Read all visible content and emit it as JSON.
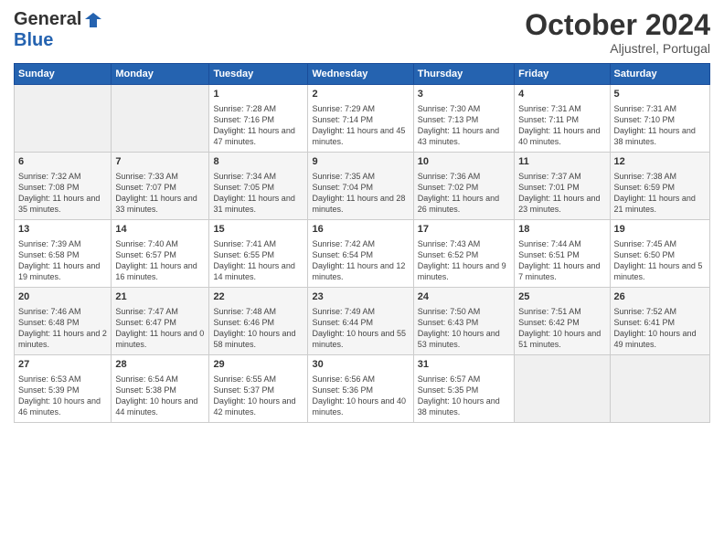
{
  "header": {
    "logo_line1": "General",
    "logo_line2": "Blue",
    "month": "October 2024",
    "location": "Aljustrel, Portugal"
  },
  "days_of_week": [
    "Sunday",
    "Monday",
    "Tuesday",
    "Wednesday",
    "Thursday",
    "Friday",
    "Saturday"
  ],
  "weeks": [
    [
      {
        "day": "",
        "content": ""
      },
      {
        "day": "",
        "content": ""
      },
      {
        "day": "1",
        "content": "Sunrise: 7:28 AM\nSunset: 7:16 PM\nDaylight: 11 hours and 47 minutes."
      },
      {
        "day": "2",
        "content": "Sunrise: 7:29 AM\nSunset: 7:14 PM\nDaylight: 11 hours and 45 minutes."
      },
      {
        "day": "3",
        "content": "Sunrise: 7:30 AM\nSunset: 7:13 PM\nDaylight: 11 hours and 43 minutes."
      },
      {
        "day": "4",
        "content": "Sunrise: 7:31 AM\nSunset: 7:11 PM\nDaylight: 11 hours and 40 minutes."
      },
      {
        "day": "5",
        "content": "Sunrise: 7:31 AM\nSunset: 7:10 PM\nDaylight: 11 hours and 38 minutes."
      }
    ],
    [
      {
        "day": "6",
        "content": "Sunrise: 7:32 AM\nSunset: 7:08 PM\nDaylight: 11 hours and 35 minutes."
      },
      {
        "day": "7",
        "content": "Sunrise: 7:33 AM\nSunset: 7:07 PM\nDaylight: 11 hours and 33 minutes."
      },
      {
        "day": "8",
        "content": "Sunrise: 7:34 AM\nSunset: 7:05 PM\nDaylight: 11 hours and 31 minutes."
      },
      {
        "day": "9",
        "content": "Sunrise: 7:35 AM\nSunset: 7:04 PM\nDaylight: 11 hours and 28 minutes."
      },
      {
        "day": "10",
        "content": "Sunrise: 7:36 AM\nSunset: 7:02 PM\nDaylight: 11 hours and 26 minutes."
      },
      {
        "day": "11",
        "content": "Sunrise: 7:37 AM\nSunset: 7:01 PM\nDaylight: 11 hours and 23 minutes."
      },
      {
        "day": "12",
        "content": "Sunrise: 7:38 AM\nSunset: 6:59 PM\nDaylight: 11 hours and 21 minutes."
      }
    ],
    [
      {
        "day": "13",
        "content": "Sunrise: 7:39 AM\nSunset: 6:58 PM\nDaylight: 11 hours and 19 minutes."
      },
      {
        "day": "14",
        "content": "Sunrise: 7:40 AM\nSunset: 6:57 PM\nDaylight: 11 hours and 16 minutes."
      },
      {
        "day": "15",
        "content": "Sunrise: 7:41 AM\nSunset: 6:55 PM\nDaylight: 11 hours and 14 minutes."
      },
      {
        "day": "16",
        "content": "Sunrise: 7:42 AM\nSunset: 6:54 PM\nDaylight: 11 hours and 12 minutes."
      },
      {
        "day": "17",
        "content": "Sunrise: 7:43 AM\nSunset: 6:52 PM\nDaylight: 11 hours and 9 minutes."
      },
      {
        "day": "18",
        "content": "Sunrise: 7:44 AM\nSunset: 6:51 PM\nDaylight: 11 hours and 7 minutes."
      },
      {
        "day": "19",
        "content": "Sunrise: 7:45 AM\nSunset: 6:50 PM\nDaylight: 11 hours and 5 minutes."
      }
    ],
    [
      {
        "day": "20",
        "content": "Sunrise: 7:46 AM\nSunset: 6:48 PM\nDaylight: 11 hours and 2 minutes."
      },
      {
        "day": "21",
        "content": "Sunrise: 7:47 AM\nSunset: 6:47 PM\nDaylight: 11 hours and 0 minutes."
      },
      {
        "day": "22",
        "content": "Sunrise: 7:48 AM\nSunset: 6:46 PM\nDaylight: 10 hours and 58 minutes."
      },
      {
        "day": "23",
        "content": "Sunrise: 7:49 AM\nSunset: 6:44 PM\nDaylight: 10 hours and 55 minutes."
      },
      {
        "day": "24",
        "content": "Sunrise: 7:50 AM\nSunset: 6:43 PM\nDaylight: 10 hours and 53 minutes."
      },
      {
        "day": "25",
        "content": "Sunrise: 7:51 AM\nSunset: 6:42 PM\nDaylight: 10 hours and 51 minutes."
      },
      {
        "day": "26",
        "content": "Sunrise: 7:52 AM\nSunset: 6:41 PM\nDaylight: 10 hours and 49 minutes."
      }
    ],
    [
      {
        "day": "27",
        "content": "Sunrise: 6:53 AM\nSunset: 5:39 PM\nDaylight: 10 hours and 46 minutes."
      },
      {
        "day": "28",
        "content": "Sunrise: 6:54 AM\nSunset: 5:38 PM\nDaylight: 10 hours and 44 minutes."
      },
      {
        "day": "29",
        "content": "Sunrise: 6:55 AM\nSunset: 5:37 PM\nDaylight: 10 hours and 42 minutes."
      },
      {
        "day": "30",
        "content": "Sunrise: 6:56 AM\nSunset: 5:36 PM\nDaylight: 10 hours and 40 minutes."
      },
      {
        "day": "31",
        "content": "Sunrise: 6:57 AM\nSunset: 5:35 PM\nDaylight: 10 hours and 38 minutes."
      },
      {
        "day": "",
        "content": ""
      },
      {
        "day": "",
        "content": ""
      }
    ]
  ]
}
